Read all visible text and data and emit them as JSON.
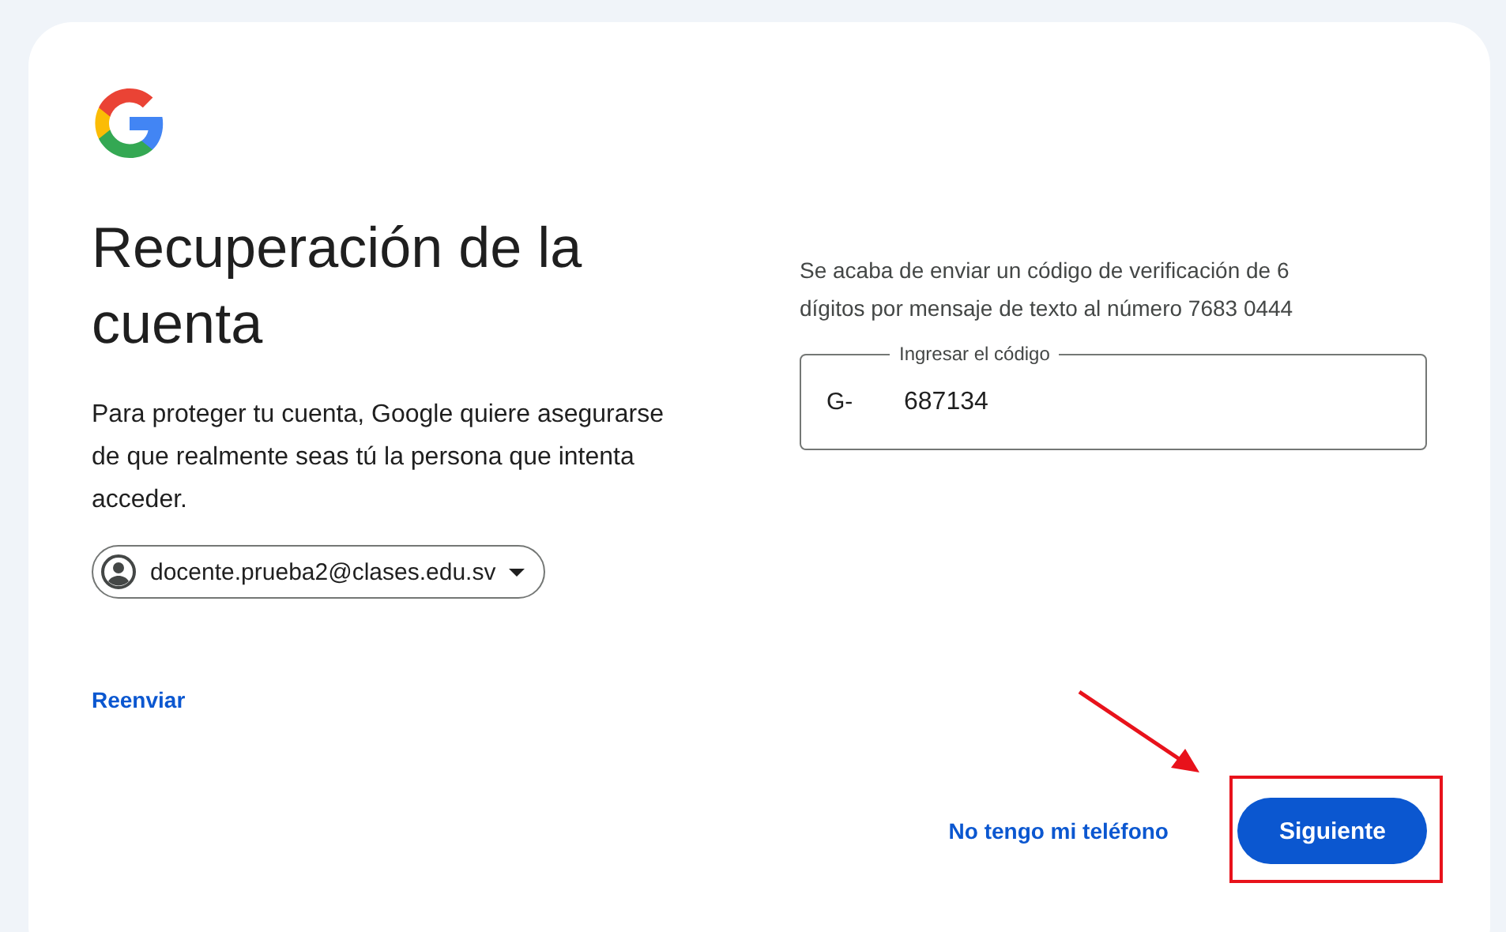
{
  "heading": "Recuperación de la cuenta",
  "description": "Para proteger tu cuenta, Google quiere asegurarse de que realmente seas tú la persona que intenta acceder.",
  "account": {
    "email": "docente.prueba2@clases.edu.sv"
  },
  "resend_link": "Reenviar",
  "sms_notice": "Se acaba de enviar un código de verificación de 6 dígitos por mensaje de texto al número 7683 0444",
  "code_field": {
    "label": "Ingresar el código",
    "prefix": "G-",
    "value": "687134"
  },
  "actions": [
    {
      "label": "No tengo mi teléfono",
      "kind": "text"
    },
    {
      "label": "Siguiente",
      "kind": "filled"
    }
  ],
  "annotations": [
    {
      "kind": "arrow"
    },
    {
      "kind": "rectangle"
    }
  ]
}
